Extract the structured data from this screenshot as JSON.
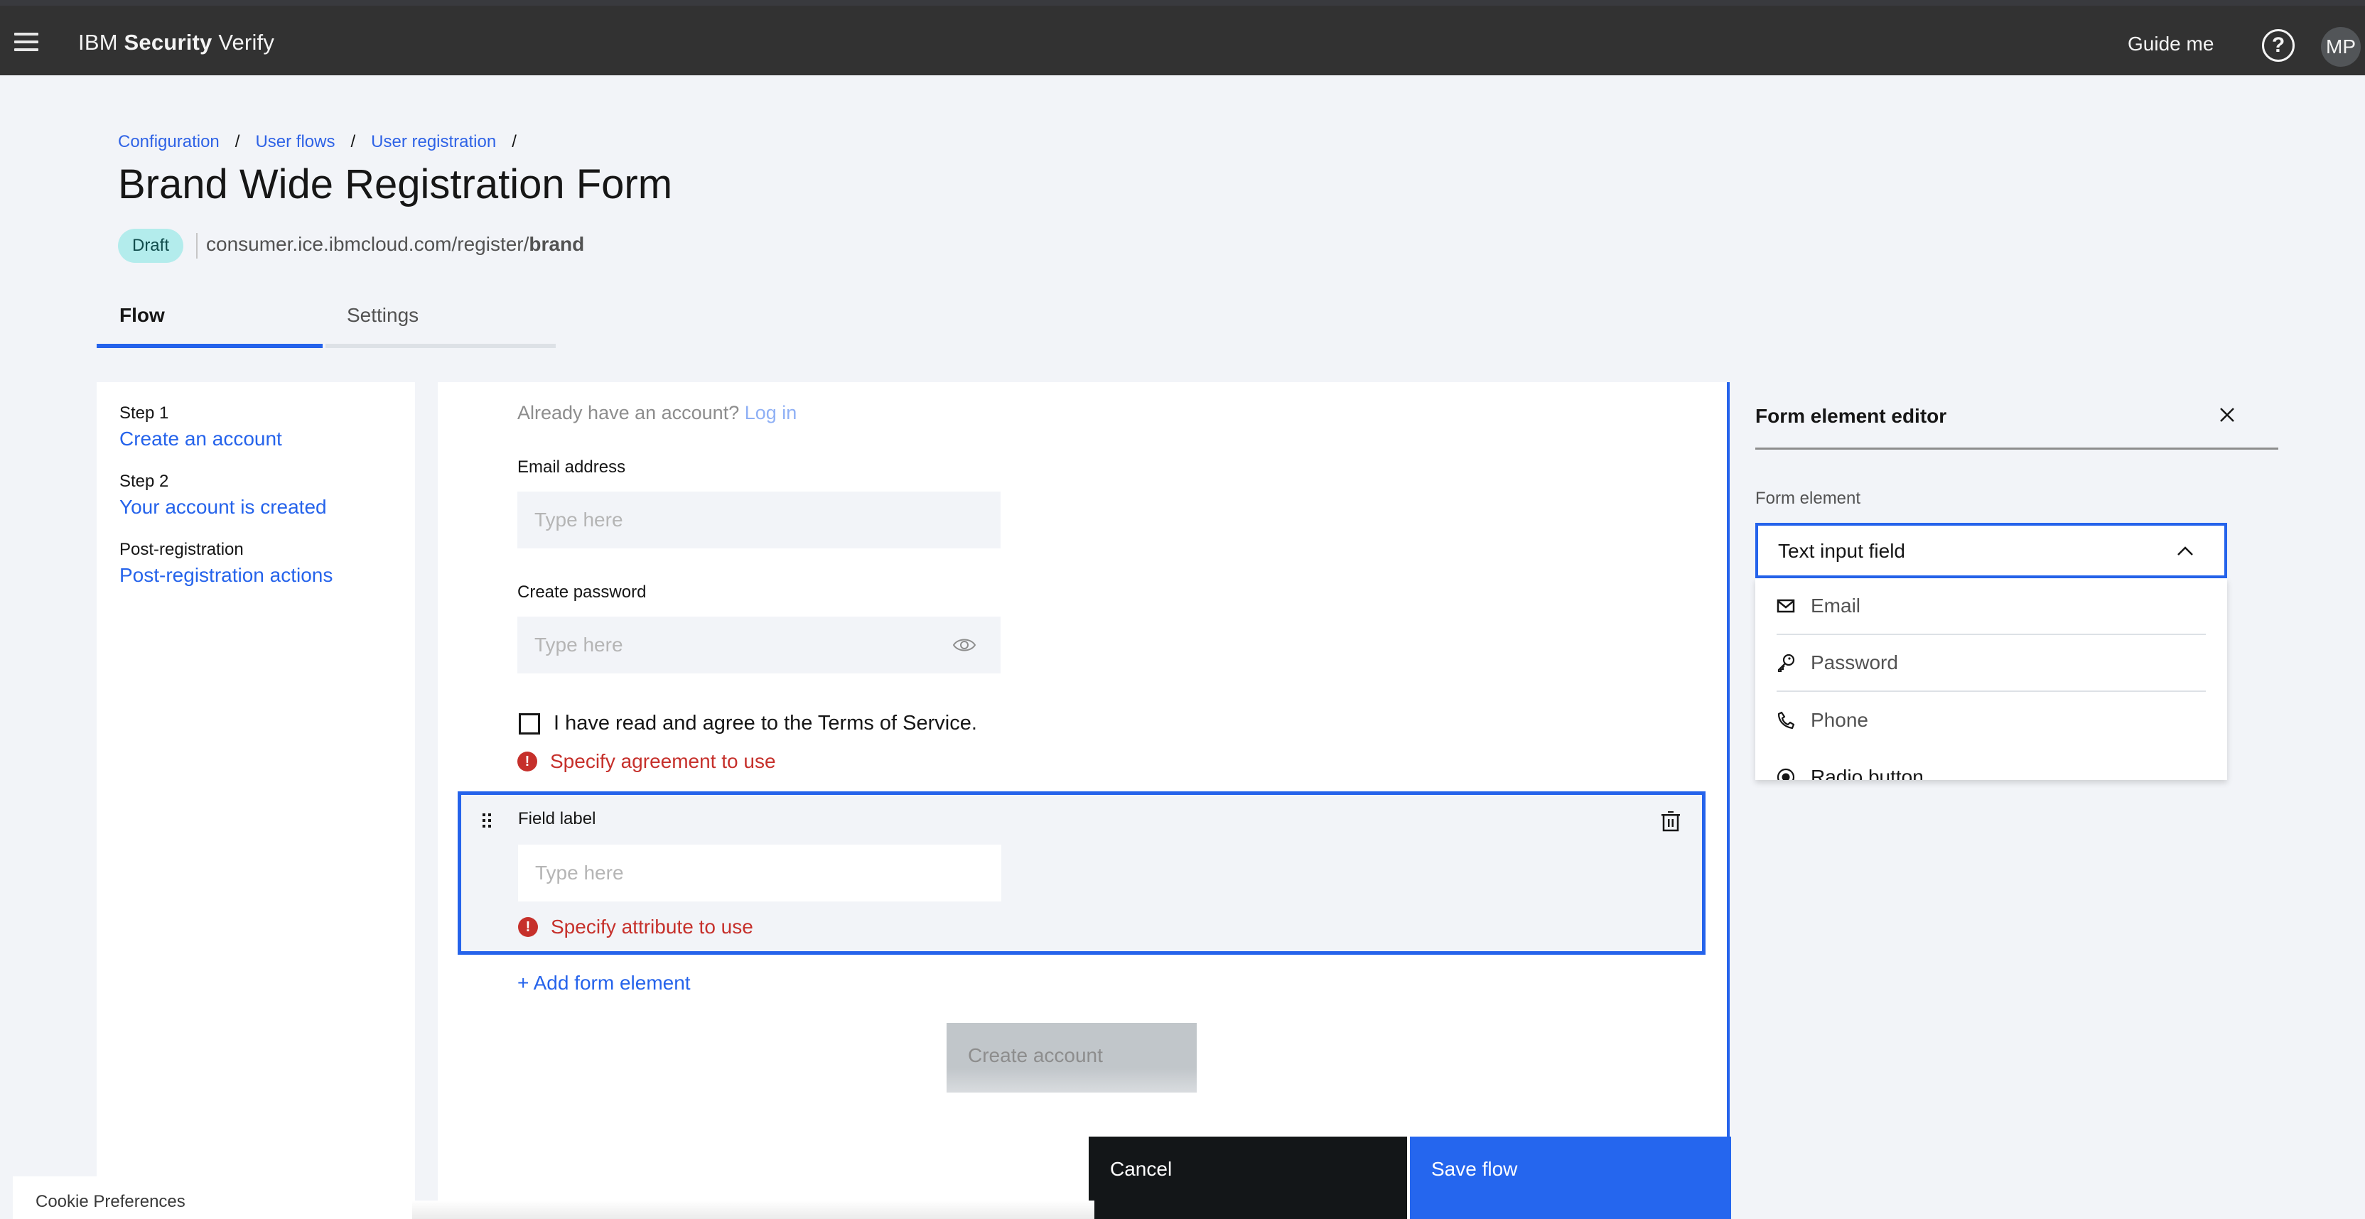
{
  "header": {
    "brand_prefix": "IBM",
    "brand_bold": "Security",
    "brand_suffix": "Verify",
    "guide_label": "Guide me",
    "help_glyph": "?",
    "avatar_initials": "MP"
  },
  "breadcrumb": {
    "items": [
      "Configuration",
      "User flows",
      "User registration"
    ],
    "separator": "/"
  },
  "page": {
    "title": "Brand Wide Registration Form",
    "status_badge": "Draft",
    "url_prefix": "consumer.ice.ibmcloud.com/register/",
    "url_bold": "brand"
  },
  "tabs": [
    {
      "label": "Flow",
      "active": true
    },
    {
      "label": "Settings",
      "active": false
    }
  ],
  "steps": [
    {
      "label": "Step 1",
      "link": "Create an account"
    },
    {
      "label": "Step 2",
      "link": "Your account is created"
    },
    {
      "label": "Post-registration",
      "link": "Post-registration actions"
    }
  ],
  "form": {
    "already_text": "Already have an account?",
    "login_link": "Log in",
    "email_label": "Email address",
    "email_placeholder": "Type here",
    "password_label": "Create password",
    "password_placeholder": "Type here",
    "terms_label": "I have read and agree to the Terms of Service.",
    "terms_checked": false,
    "terms_error": "Specify agreement to use",
    "selected_block": {
      "label": "Field label",
      "placeholder": "Type here",
      "error": "Specify attribute to use"
    },
    "add_element_label": "+ Add form element",
    "create_account_label": "Create account"
  },
  "actions": {
    "cancel_label": "Cancel",
    "save_label": "Save flow"
  },
  "cookie": {
    "label": "Cookie Preferences"
  },
  "editor": {
    "title": "Form element editor",
    "field_label": "Form element",
    "selected_value": "Text input field",
    "options": [
      {
        "label": "Email",
        "icon": "email-icon"
      },
      {
        "label": "Password",
        "icon": "key-icon"
      },
      {
        "label": "Phone",
        "icon": "phone-icon"
      },
      {
        "label": "Radio button",
        "icon": "radio-button-icon"
      }
    ]
  },
  "colors": {
    "accent": "#2563eb",
    "error": "#c6302b",
    "header_bg": "#323232",
    "badge_bg": "#b3ecec"
  }
}
